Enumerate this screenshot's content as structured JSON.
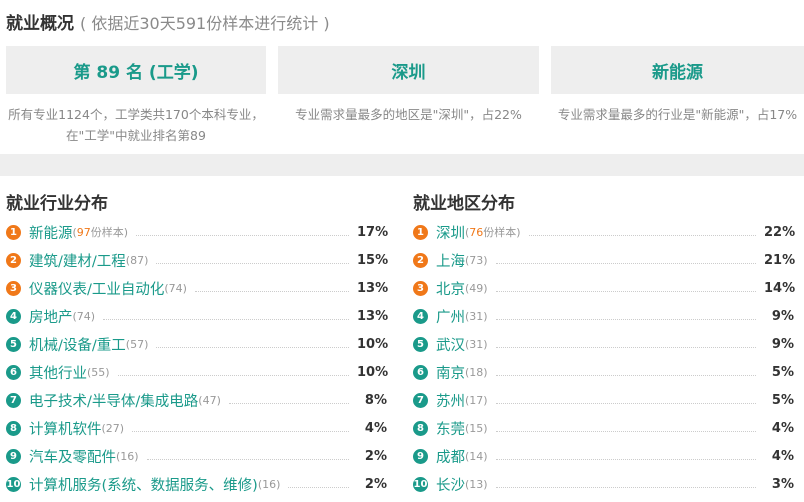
{
  "header": {
    "title": "就业概况",
    "subtitle": "( 依据近30天591份样本进行统计 )"
  },
  "cards": [
    {
      "label": "第 89 名 (工学)",
      "desc": "所有专业1124个，工学类共170个本科专业，在\"工学\"中就业排名第89"
    },
    {
      "label": "深圳",
      "desc": "专业需求量最多的地区是\"深圳\"，占22%"
    },
    {
      "label": "新能源",
      "desc": "专业需求量最多的行业是\"新能源\"，占17%"
    }
  ],
  "industry": {
    "title": "就业行业分布",
    "items": [
      {
        "rank": "1",
        "name": "新能源",
        "count": "97",
        "suffix": "份样本",
        "percent": "17%"
      },
      {
        "rank": "2",
        "name": "建筑/建材/工程",
        "count": "(87)",
        "suffix": "",
        "percent": "15%"
      },
      {
        "rank": "3",
        "name": "仪器仪表/工业自动化",
        "count": "(74)",
        "suffix": "",
        "percent": "13%"
      },
      {
        "rank": "4",
        "name": "房地产",
        "count": "(74)",
        "suffix": "",
        "percent": "13%"
      },
      {
        "rank": "5",
        "name": "机械/设备/重工",
        "count": "(57)",
        "suffix": "",
        "percent": "10%"
      },
      {
        "rank": "6",
        "name": "其他行业",
        "count": "(55)",
        "suffix": "",
        "percent": "10%"
      },
      {
        "rank": "7",
        "name": "电子技术/半导体/集成电路",
        "count": "(47)",
        "suffix": "",
        "percent": "8%"
      },
      {
        "rank": "8",
        "name": "计算机软件",
        "count": "(27)",
        "suffix": "",
        "percent": "4%"
      },
      {
        "rank": "9",
        "name": "汽车及零配件",
        "count": "(16)",
        "suffix": "",
        "percent": "2%"
      },
      {
        "rank": "10",
        "name": "计算机服务(系统、数据服务、维修)",
        "count": "(16)",
        "suffix": "",
        "percent": "2%"
      }
    ]
  },
  "region": {
    "title": "就业地区分布",
    "items": [
      {
        "rank": "1",
        "name": "深圳",
        "count": "76",
        "suffix": "份样本",
        "percent": "22%"
      },
      {
        "rank": "2",
        "name": "上海",
        "count": "(73)",
        "suffix": "",
        "percent": "21%"
      },
      {
        "rank": "3",
        "name": "北京",
        "count": "(49)",
        "suffix": "",
        "percent": "14%"
      },
      {
        "rank": "4",
        "name": "广州",
        "count": "(31)",
        "suffix": "",
        "percent": "9%"
      },
      {
        "rank": "5",
        "name": "武汉",
        "count": "(31)",
        "suffix": "",
        "percent": "9%"
      },
      {
        "rank": "6",
        "name": "南京",
        "count": "(18)",
        "suffix": "",
        "percent": "5%"
      },
      {
        "rank": "7",
        "name": "苏州",
        "count": "(17)",
        "suffix": "",
        "percent": "5%"
      },
      {
        "rank": "8",
        "name": "东莞",
        "count": "(15)",
        "suffix": "",
        "percent": "4%"
      },
      {
        "rank": "9",
        "name": "成都",
        "count": "(14)",
        "suffix": "",
        "percent": "4%"
      },
      {
        "rank": "10",
        "name": "长沙",
        "count": "(13)",
        "suffix": "",
        "percent": "3%"
      }
    ]
  },
  "colors": {
    "accent": "#1a9a8a",
    "top_rank": "#f07819",
    "card_bg": "#eeeeee"
  }
}
